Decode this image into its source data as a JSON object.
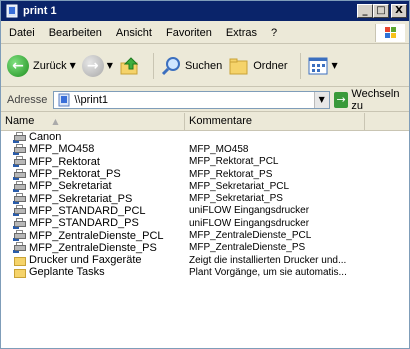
{
  "window": {
    "title": "print 1"
  },
  "titlebar_buttons": {
    "minimize": "_",
    "maximize": "□",
    "close": "X"
  },
  "menu": [
    "Datei",
    "Bearbeiten",
    "Ansicht",
    "Favoriten",
    "Extras",
    "?"
  ],
  "toolbar": {
    "back_label": "Zurück",
    "search_label": "Suchen",
    "folders_label": "Ordner"
  },
  "address": {
    "label": "Adresse",
    "value": "\\\\print1",
    "go_label": "Wechseln zu"
  },
  "columns": {
    "name": "Name",
    "comment": "Kommentare"
  },
  "rows": [
    {
      "name": "Canon",
      "comment": "",
      "icon": "add-printer-icon"
    },
    {
      "name": "MFP_MO458",
      "comment": "MFP_MO458",
      "icon": "network-printer-icon"
    },
    {
      "name": "MFP_Rektorat",
      "comment": "MFP_Rektorat_PCL",
      "icon": "network-printer-icon"
    },
    {
      "name": "MFP_Rektorat_PS",
      "comment": "MFP_Rektorat_PS",
      "icon": "network-printer-icon"
    },
    {
      "name": "MFP_Sekretariat",
      "comment": "MFP_Sekretariat_PCL",
      "icon": "network-printer-icon"
    },
    {
      "name": "MFP_Sekretariat_PS",
      "comment": "MFP_Sekretariat_PS",
      "icon": "network-printer-icon"
    },
    {
      "name": "MFP_STANDARD_PCL",
      "comment": "uniFLOW Eingangsdrucker",
      "icon": "network-printer-icon"
    },
    {
      "name": "MFP_STANDARD_PS",
      "comment": "uniFLOW Eingangsdrucker",
      "icon": "network-printer-icon"
    },
    {
      "name": "MFP_ZentraleDienste_PCL",
      "comment": "MFP_ZentraleDienste_PCL",
      "icon": "network-printer-icon"
    },
    {
      "name": "MFP_ZentraleDienste_PS",
      "comment": "MFP_ZentraleDienste_PS",
      "icon": "network-printer-icon"
    },
    {
      "name": "Drucker und Faxgeräte",
      "comment": "Zeigt die installierten Drucker und...",
      "icon": "printers-folder-icon"
    },
    {
      "name": "Geplante Tasks",
      "comment": "Plant Vorgänge, um sie automatis...",
      "icon": "scheduled-tasks-folder-icon"
    }
  ]
}
